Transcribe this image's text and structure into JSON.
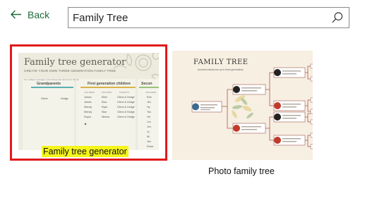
{
  "header": {
    "back_label": "Back",
    "search_value": "Family Tree"
  },
  "templates": [
    {
      "label": "Family tree generator",
      "selected": true,
      "thumb": {
        "title": "Family tree generator",
        "subtitle": "CREATE YOUR OWN THREE GENERATION FAMILY TREE",
        "note": "For multiple marriages, enter Name and name from the list",
        "columns": [
          "Grandparents",
          "First generation children",
          "Secon"
        ],
        "grandparents": [
          "Glenn",
          "Hodge"
        ],
        "children_headers": [
          "CHILDREN",
          "SPOUSES",
          "PARENTS"
        ],
        "children_rows": [
          [
            "James",
            "Ellen",
            "Glenn & Hodge"
          ],
          [
            "James",
            "Elsa",
            "Glenn & Hodge"
          ],
          [
            "Wendy",
            "Ryan",
            "Glenn & Hodge"
          ],
          [
            "Wendy",
            "Stan",
            "Glenn & Hodge"
          ],
          [
            "Royce",
            "Meena",
            "Glenn & Hodge"
          ]
        ],
        "second_header": "CHILDREN",
        "second_names": [
          "Rob",
          "Jim",
          "Hy",
          "Yos",
          "Yel",
          "Lox",
          "Jon",
          "Ly",
          "Mi",
          "Jim",
          "Rowe",
          "Sue",
          "Sarit"
        ]
      }
    },
    {
      "label": "Photo family tree",
      "selected": false,
      "thumb": {
        "title": "FAMILY TREE",
        "subtitle": "Ancestral family tree up to three generations"
      }
    }
  ],
  "colors": {
    "accent_green": "#1e6b3a",
    "selection_red": "#e2191b",
    "highlight_yellow": "#f5f51c"
  }
}
